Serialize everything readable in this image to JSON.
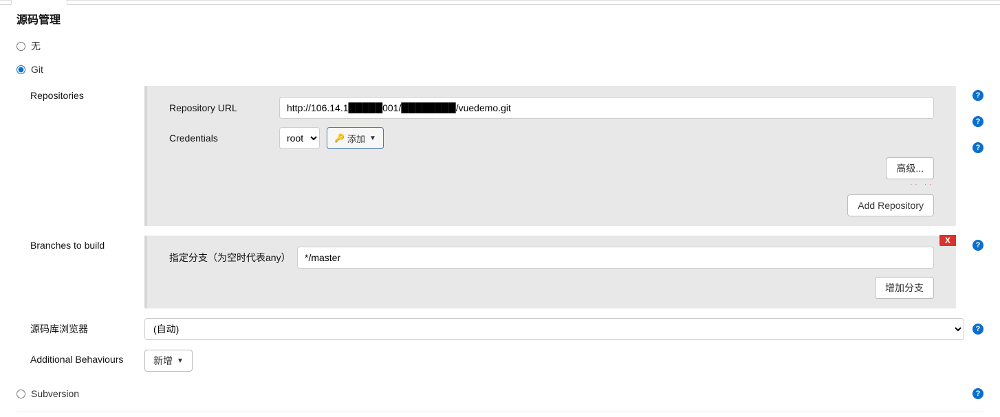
{
  "section_title": "源码管理",
  "scm": {
    "none_label": "无",
    "git_label": "Git",
    "subversion_label": "Subversion"
  },
  "repositories": {
    "label": "Repositories",
    "url_label": "Repository URL",
    "url_value": "http://106.14.1█████001/████████/vuedemo.git",
    "credentials_label": "Credentials",
    "credential_selected": "root",
    "add_label": "添加",
    "advanced_label": "高级...",
    "add_repo_label": "Add Repository"
  },
  "branches": {
    "label": "Branches to build",
    "spec_label": "指定分支（为空时代表any）",
    "spec_value": "*/master",
    "add_branch_label": "增加分支",
    "close_label": "X"
  },
  "browser": {
    "label": "源码库浏览器",
    "selected": "(自动)"
  },
  "behaviours": {
    "label": "Additional Behaviours",
    "add_label": "新增"
  },
  "help_glyph": "?"
}
